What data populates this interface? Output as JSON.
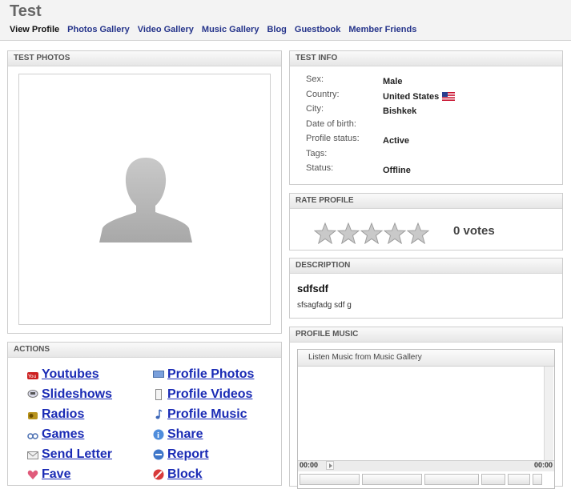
{
  "page": {
    "title": "Test"
  },
  "nav": [
    "View Profile",
    "Photos Gallery",
    "Video Gallery",
    "Music Gallery",
    "Blog",
    "Guestbook",
    "Member Friends"
  ],
  "photos": {
    "heading": "TEST PHOTOS"
  },
  "info": {
    "heading": "TEST INFO",
    "rows": [
      {
        "label": "Sex:",
        "value": "Male"
      },
      {
        "label": "Country:",
        "value": "United States"
      },
      {
        "label": "City:",
        "value": "Bishkek"
      },
      {
        "label": "Date of birth:",
        "value": ""
      },
      {
        "label": "Profile status:",
        "value": "Active"
      },
      {
        "label": "Tags:",
        "value": ""
      },
      {
        "label": "Status:",
        "value": "Offline"
      }
    ]
  },
  "rate": {
    "heading": "RATE PROFILE",
    "votes": "0 votes",
    "rating": 0,
    "max": 5
  },
  "description": {
    "heading": "DESCRIPTION",
    "title": "sdfsdf",
    "text": "sfsagfadg sdf g"
  },
  "music": {
    "heading": "PROFILE MUSIC",
    "player_title": "Listen Music from Music Gallery",
    "time_start": "00:00",
    "time_end": "00:00"
  },
  "actions": {
    "heading": "ACTIONS",
    "left": [
      {
        "label": "Youtubes",
        "icon": "youtube-icon"
      },
      {
        "label": "Slideshows",
        "icon": "slideshow-icon"
      },
      {
        "label": "Radios",
        "icon": "radio-icon"
      },
      {
        "label": "Games",
        "icon": "games-icon"
      },
      {
        "label": "Send Letter",
        "icon": "letter-icon"
      },
      {
        "label": "Fave",
        "icon": "heart-icon"
      }
    ],
    "right": [
      {
        "label": "Profile Photos",
        "icon": "photos-icon"
      },
      {
        "label": "Profile Videos",
        "icon": "video-icon"
      },
      {
        "label": "Profile Music",
        "icon": "music-note-icon"
      },
      {
        "label": "Share",
        "icon": "share-icon"
      },
      {
        "label": "Report",
        "icon": "report-icon"
      },
      {
        "label": "Block",
        "icon": "block-icon"
      }
    ]
  }
}
